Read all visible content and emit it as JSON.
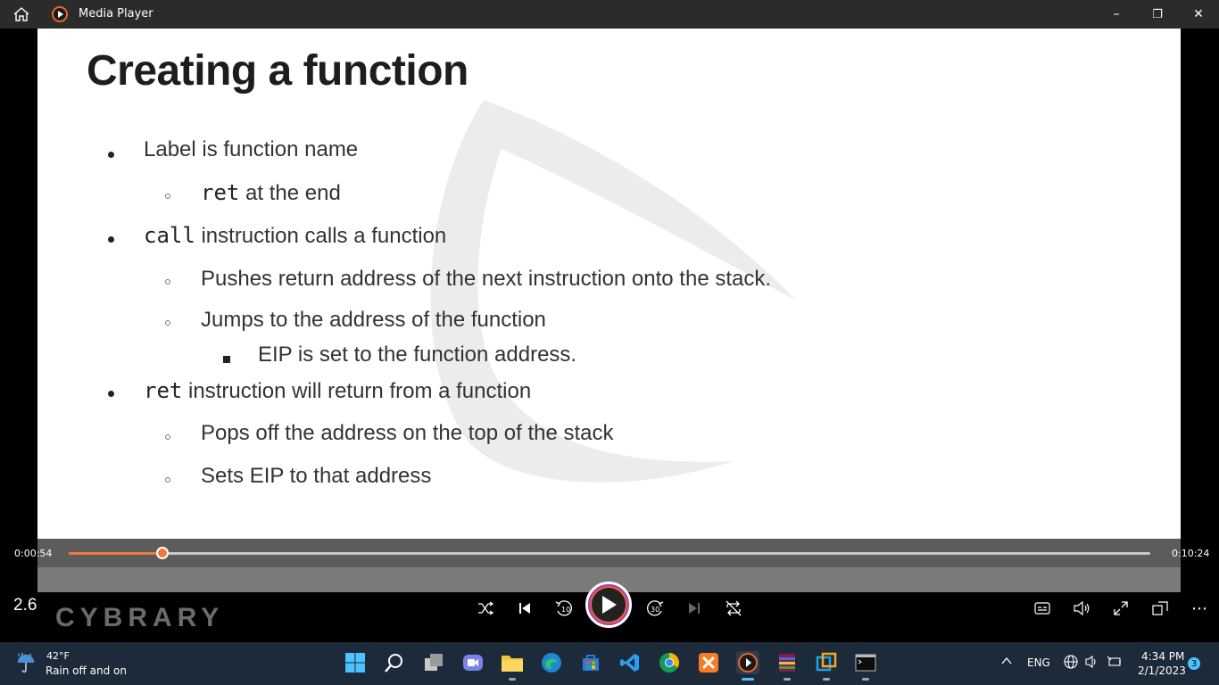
{
  "window": {
    "title": "Media Player",
    "minimize": "–",
    "maximize": "❐",
    "close": "✕"
  },
  "slide": {
    "title": "Creating a function",
    "bullets": {
      "b1": {
        "text": "Label is function name"
      },
      "b1a": {
        "code": "ret",
        "text": " at the end"
      },
      "b2": {
        "code": "call",
        "text": " instruction calls a function"
      },
      "b2a": {
        "text": "Pushes return address of the next instruction onto the stack."
      },
      "b2b": {
        "text": "Jumps to the address of the function"
      },
      "b2b1": {
        "text": "EIP is set to the function address."
      },
      "b3": {
        "code": "ret",
        "text": " instruction will return from a function"
      },
      "b3a": {
        "text": "Pops off the address on the top of the stack"
      },
      "b3b": {
        "text": "Sets EIP to that address"
      }
    }
  },
  "player": {
    "elapsed": "0:00:54",
    "duration": "0:10:24",
    "progress_fraction": 0.087,
    "speed": "2.6",
    "brand": "CYBRARY",
    "accent_color": "#f07a3a"
  },
  "taskbar": {
    "weather": {
      "temp": "42°F",
      "desc": "Rain off and on"
    },
    "language": "ENG",
    "time": "4:34 PM",
    "date": "2/1/2023",
    "notifications": "3"
  }
}
